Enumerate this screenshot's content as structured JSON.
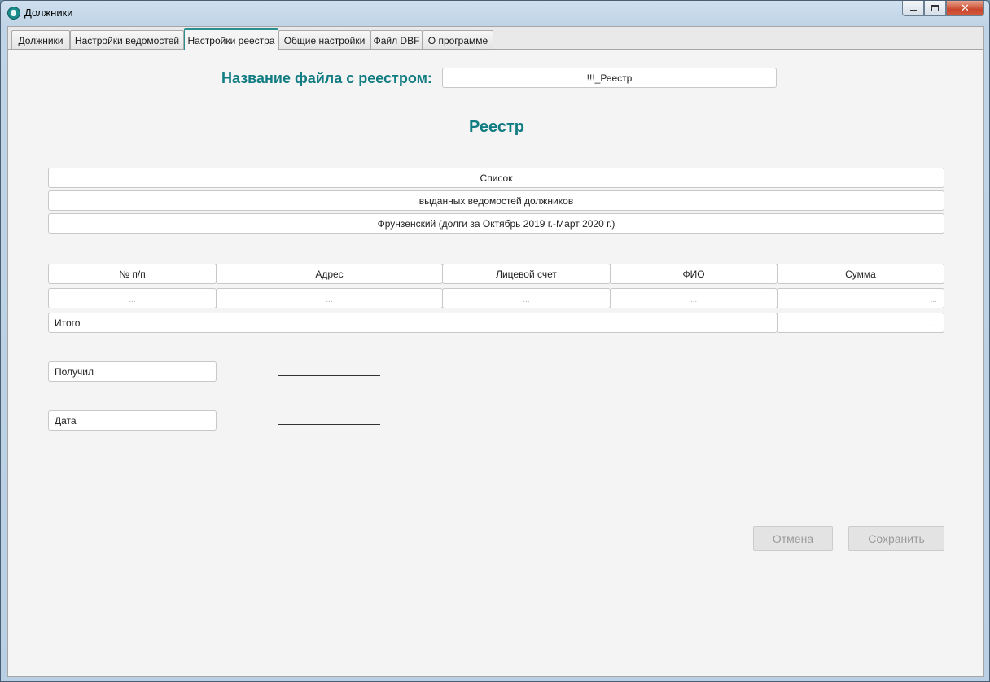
{
  "window": {
    "title": "Должники"
  },
  "tabs": [
    {
      "label": "Должники"
    },
    {
      "label": "Настройки ведомостей"
    },
    {
      "label": "Настройки реестра"
    },
    {
      "label": "Общие настройки"
    },
    {
      "label": "Файл DBF"
    },
    {
      "label": "О программе"
    }
  ],
  "active_tab": "Настройки реестра",
  "filename": {
    "label": "Название файла с реестром:",
    "value": "!!!_Реестр"
  },
  "registry": {
    "title": "Реестр",
    "header_lines": [
      "Список",
      "выданных ведомостей должников",
      "Фрунзенский (долги за Октябрь 2019 г.-Март 2020 г.)"
    ],
    "columns": [
      "№ п/п",
      "Адрес",
      "Лицевой счет",
      "ФИО",
      "Сумма"
    ],
    "row_placeholders": [
      "...",
      "...",
      "...",
      "...",
      "..."
    ],
    "total_label": "Итого",
    "total_placeholder": "...",
    "received_label": "Получил",
    "date_label": "Дата"
  },
  "buttons": {
    "cancel": "Отмена",
    "save": "Сохранить"
  },
  "colors": {
    "accent": "#117c82",
    "active_tab_border": "#2a8f8f"
  }
}
